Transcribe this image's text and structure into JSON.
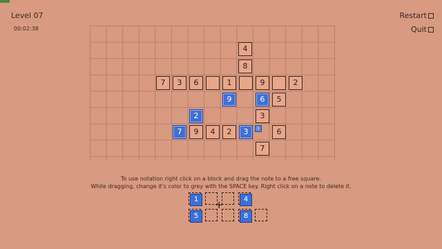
{
  "header": {
    "level": "Level 07",
    "timer": "00:02:38",
    "restart": "Restart",
    "quit": "Quit"
  },
  "board": {
    "cells": [
      {
        "value": "4",
        "style": "plain"
      },
      {
        "value": "8",
        "style": "plain"
      },
      {
        "value": "7",
        "style": "plain"
      },
      {
        "value": "3",
        "style": "plain"
      },
      {
        "value": "6",
        "style": "plain"
      },
      {
        "value": "",
        "style": "plain"
      },
      {
        "value": "1",
        "style": "plain"
      },
      {
        "value": "",
        "style": "plain"
      },
      {
        "value": "9",
        "style": "plain"
      },
      {
        "value": "",
        "style": "plain"
      },
      {
        "value": "2",
        "style": "plain"
      },
      {
        "value": "9",
        "style": "blue"
      },
      {
        "value": "6",
        "style": "blue"
      },
      {
        "value": "5",
        "style": "plain"
      },
      {
        "value": "2",
        "style": "blue"
      },
      {
        "value": "3",
        "style": "plain"
      },
      {
        "value": "7",
        "style": "blue"
      },
      {
        "value": "9",
        "style": "plain"
      },
      {
        "value": "4",
        "style": "plain"
      },
      {
        "value": "2",
        "style": "plain"
      },
      {
        "value": "3",
        "style": "blue"
      },
      {
        "value": "6",
        "style": "plain"
      },
      {
        "value": "7",
        "style": "plain"
      }
    ],
    "note": "1"
  },
  "instructions": {
    "line1": "To use notation right click on a block and drag the note to a free square.",
    "line2": "While dragging, change it's color to grey with the SPACE key. Right click on a note to delete it."
  },
  "palette": {
    "blocks": [
      "1",
      "4",
      "5",
      "8"
    ]
  },
  "colors": {
    "background": "#d89a80",
    "blue_block": "#3f6fd6",
    "plain_block": "#e7a78b"
  }
}
